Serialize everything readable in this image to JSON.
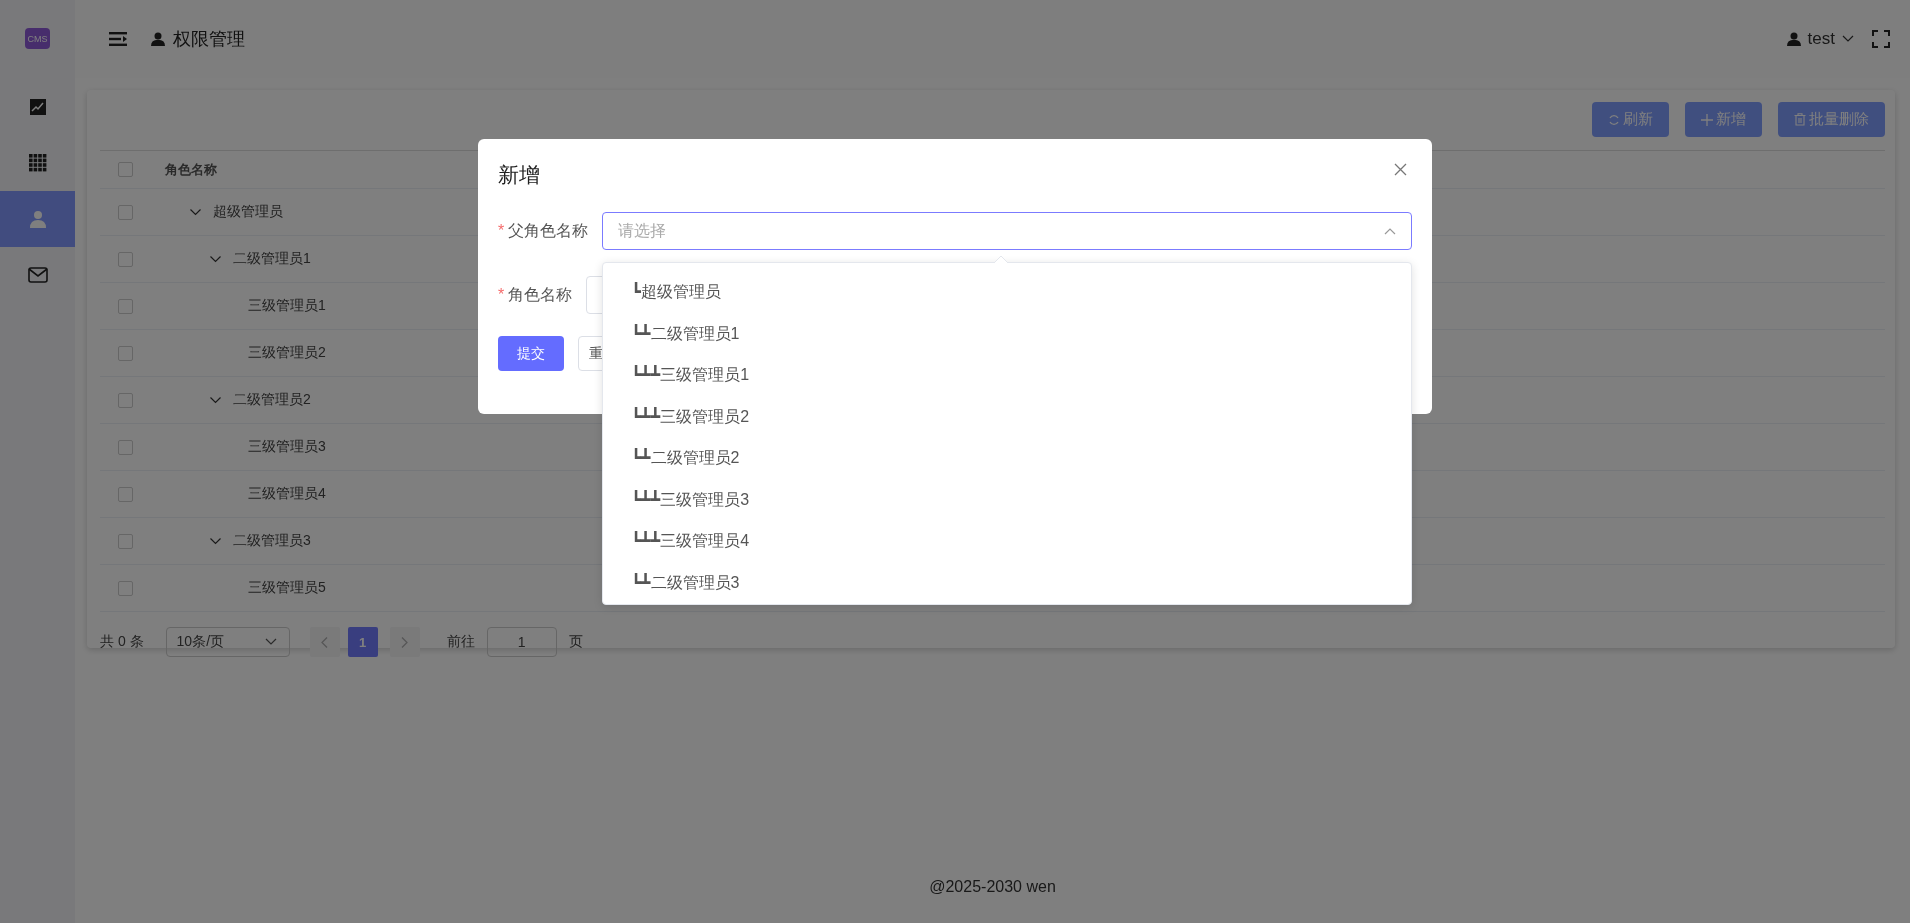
{
  "sidebar": {
    "logo": "CMS",
    "items": [
      {
        "kind": "chart",
        "selected": false
      },
      {
        "kind": "grid",
        "selected": false
      },
      {
        "kind": "user",
        "selected": true
      },
      {
        "kind": "mail",
        "selected": false
      }
    ]
  },
  "header": {
    "page_title": "权限管理",
    "user": "test"
  },
  "toolbar": {
    "buttons": [
      {
        "kind": "refresh",
        "label": "刷新"
      },
      {
        "kind": "add",
        "label": "新增"
      },
      {
        "kind": "delete",
        "label": "批量删除"
      }
    ]
  },
  "table": {
    "header_checked": false,
    "columns": [
      "角色名称"
    ],
    "rows": [
      {
        "name": "超级管理员",
        "checked": false,
        "expanded": true,
        "children": [
          {
            "name": "二级管理员1",
            "checked": false,
            "expanded": true,
            "children": [
              {
                "name": "三级管理员1",
                "checked": false
              },
              {
                "name": "三级管理员2",
                "checked": false
              }
            ]
          },
          {
            "name": "二级管理员2",
            "checked": false,
            "expanded": true,
            "children": [
              {
                "name": "三级管理员3",
                "checked": false
              },
              {
                "name": "三级管理员4",
                "checked": false
              }
            ]
          },
          {
            "name": "二级管理员3",
            "checked": false,
            "expanded": true,
            "children": [
              {
                "name": "三级管理员5",
                "checked": false
              }
            ]
          }
        ]
      }
    ]
  },
  "pagination": {
    "total": "共 0 条",
    "page_size": "10条/页",
    "pages": [
      {
        "label": "1",
        "selected": true
      }
    ],
    "goto_label": "前往",
    "goto_value": "1",
    "page_suffix": "页"
  },
  "footer": "@2025-2030 wen",
  "dialog": {
    "title": "新增",
    "fields": [
      {
        "required_mark": "*",
        "label": "父角色名称",
        "placeholder": "请选择",
        "open": true,
        "options": [
          "┗超级管理员",
          "┗┻二级管理员1",
          "┗┻┻三级管理员1",
          "┗┻┻三级管理员2",
          "┗┻二级管理员2",
          "┗┻┻三级管理员3",
          "┗┻┻三级管理员4",
          "┗┻二级管理员3"
        ]
      },
      {
        "required_mark": "*",
        "label": "角色名称"
      }
    ],
    "buttons": [
      {
        "kind": "primary",
        "label": "提交"
      },
      {
        "kind": "default",
        "label": "重"
      }
    ]
  }
}
